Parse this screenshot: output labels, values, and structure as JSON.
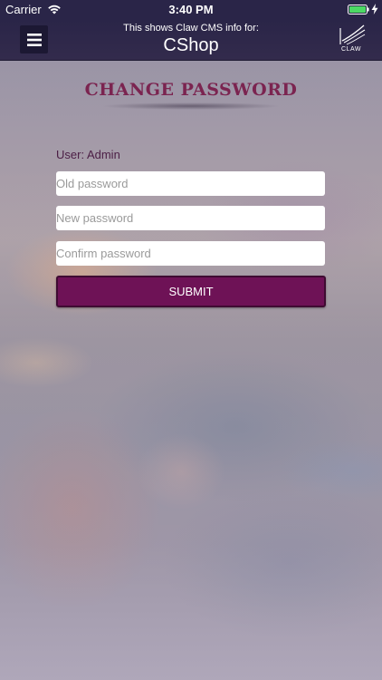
{
  "status_bar": {
    "carrier": "Carrier",
    "time": "3:40 PM"
  },
  "nav": {
    "caption": "This shows Claw CMS info for:",
    "title": "CShop",
    "logo_text": "CLAW"
  },
  "form": {
    "title": "CHANGE PASSWORD",
    "user_label": "User: Admin",
    "old_password_placeholder": "Old password",
    "new_password_placeholder": "New password",
    "confirm_password_placeholder": "Confirm password",
    "submit_label": "SUBMIT"
  },
  "colors": {
    "nav_background": "#2a2548",
    "accent": "#6e1256",
    "title_color": "#7b2450"
  },
  "icons": {
    "menu": "hamburger-menu-icon",
    "wifi": "wifi-icon",
    "battery": "battery-icon",
    "charging": "charging-icon",
    "logo": "claw-logo-icon"
  }
}
